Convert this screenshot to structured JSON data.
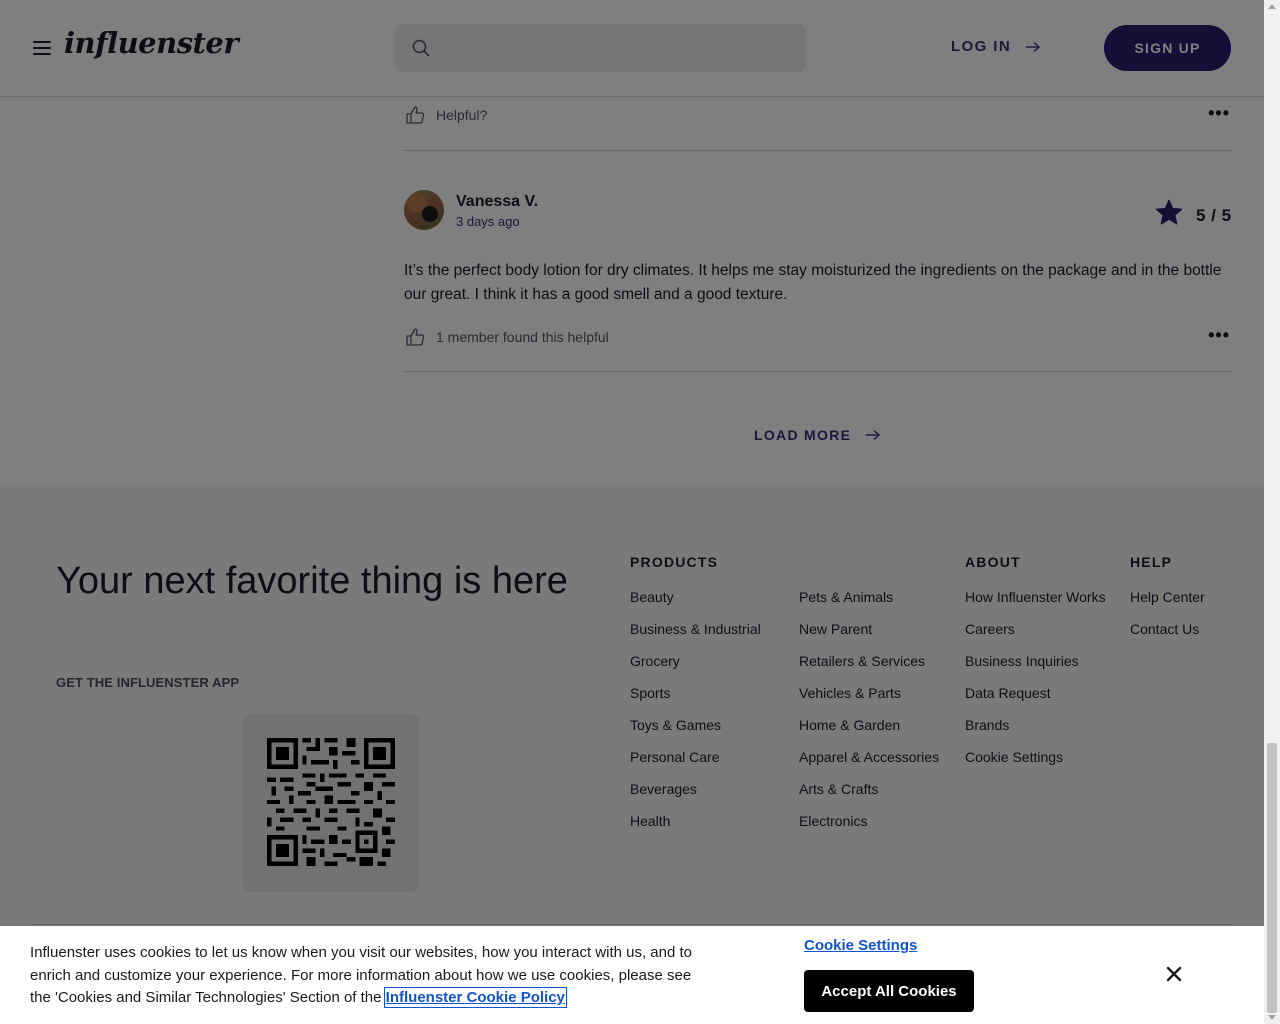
{
  "header": {
    "logo": "influenster",
    "search_placeholder": "",
    "login_label": "LOG IN",
    "signup_label": "SIGN UP"
  },
  "reviews": {
    "previous_review": {
      "helpful_text": "Helpful?"
    },
    "items": [
      {
        "author": "Vanessa V.",
        "date": "3 days ago",
        "rating": "5 / 5",
        "text": "It’s the perfect body lotion for dry climates. It helps me stay moisturized the ingredients on the package and in the bottle our great. I think it has a good smell and a good texture.",
        "helpful_text": "1 member found this helpful"
      }
    ],
    "load_more_label": "LOAD MORE"
  },
  "footer": {
    "title": "Your next favorite thing is here",
    "app_label": "GET THE INFLUENSTER APP",
    "products_heading": "PRODUCTS",
    "products_col1": [
      "Beauty",
      "Business & Industrial",
      "Grocery",
      "Sports",
      "Toys & Games",
      "Personal Care",
      "Beverages",
      "Health"
    ],
    "products_col2": [
      "Pets & Animals",
      "New Parent",
      "Retailers & Services",
      "Vehicles & Parts",
      "Home & Garden",
      "Apparel & Accessories",
      "Arts & Crafts",
      "Electronics"
    ],
    "about_heading": "ABOUT",
    "about_links": [
      "How Influenster Works",
      "Careers",
      "Business Inquiries",
      "Data Request",
      "Brands",
      "Cookie Settings"
    ],
    "help_heading": "HELP",
    "help_links": [
      "Help Center",
      "Contact Us"
    ]
  },
  "cookie_banner": {
    "text": "Influenster uses cookies to let us know when you visit our websites, how you interact with us, and to enrich and customize your experience. For more information about how we use cookies, please see the 'Cookies and Similar Technologies' Section of the",
    "policy_link": "Influenster Cookie Policy",
    "settings_label": "Cookie Settings",
    "accept_label": "Accept All Cookies"
  },
  "colors": {
    "brand_purple": "#2d1d6e",
    "accent_purple": "#3a2e78",
    "link_blue": "#1155cc",
    "footer_bg": "#f5f5f7"
  },
  "icons": [
    "menu-icon",
    "search-icon",
    "arrow-right-icon",
    "thumbs-up-icon",
    "more-icon",
    "star-icon",
    "qr-code",
    "close-icon"
  ]
}
